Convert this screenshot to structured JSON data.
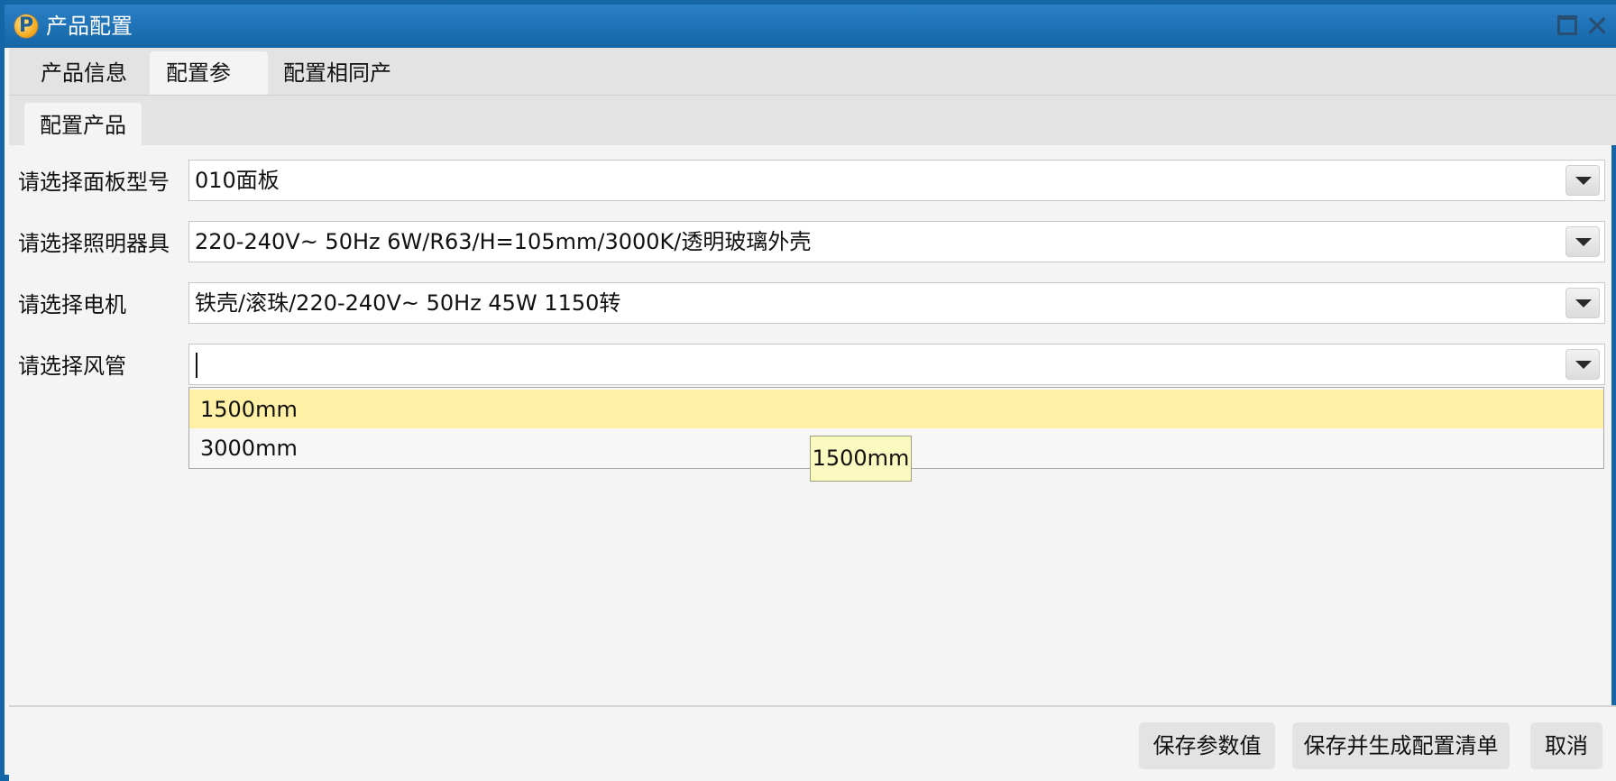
{
  "window": {
    "title": "产品配置"
  },
  "tabs": [
    {
      "label": "产品信息",
      "active": false
    },
    {
      "label": "配置参数",
      "active": true
    },
    {
      "label": "配置相同产品",
      "active": false
    }
  ],
  "subtabs": [
    {
      "label": "配置产品",
      "active": true
    }
  ],
  "form": {
    "rows": [
      {
        "label": "请选择面板型号",
        "value": "010面板"
      },
      {
        "label": "请选择照明器具",
        "value": "220-240V~ 50Hz 6W/R63/H=105mm/3000K/透明玻璃外壳"
      },
      {
        "label": "请选择电机",
        "value": "铁壳/滚珠/220-240V~ 50Hz 45W 1150转"
      },
      {
        "label": "请选择风管",
        "value": ""
      }
    ]
  },
  "dropdown": {
    "options": [
      "1500mm",
      "3000mm"
    ],
    "highlighted": "1500mm"
  },
  "tooltip": {
    "text": "1500mm"
  },
  "buttons": {
    "save_params": "保存参数值",
    "save_generate": "保存并生成配置清单",
    "cancel": "取消"
  },
  "colors": {
    "titlebar": "#1466a6",
    "highlight": "#fff0a5",
    "tooltip": "#fafac0"
  },
  "icons": [
    "app-logo-icon",
    "maximize-icon",
    "close-icon",
    "chevron-down-icon"
  ]
}
